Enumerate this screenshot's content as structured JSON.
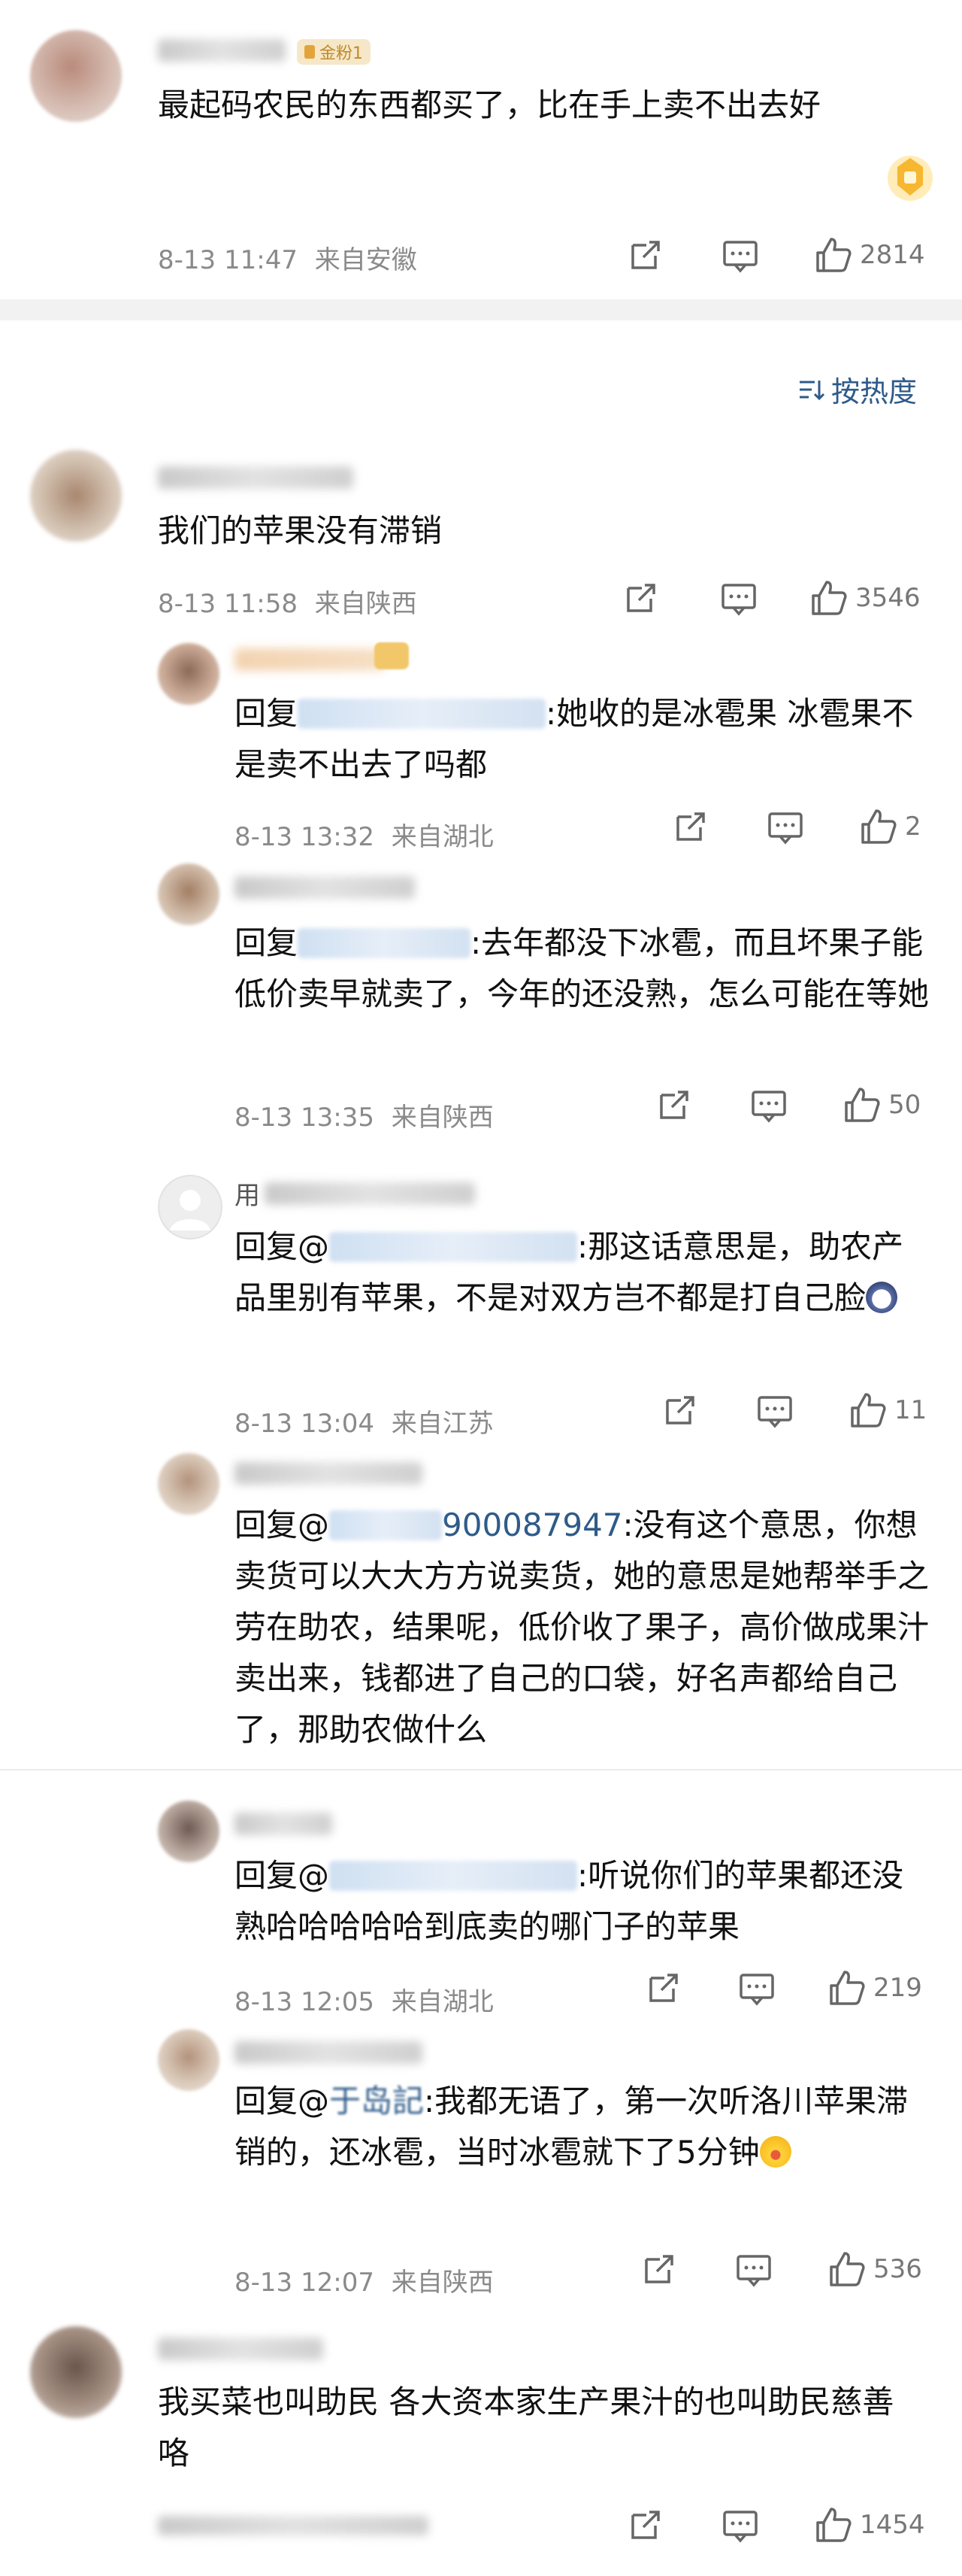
{
  "comments": [
    {
      "text": "最起码农民的东西都买了，比在手上卖不出去好",
      "time": "8-13 11:47",
      "location": "来自安徽",
      "likes": "2814"
    },
    {
      "text": "我们的苹果没有滞销",
      "time": "8-13 11:58",
      "location": "来自陕西",
      "likes": "3546"
    },
    {
      "text": "我买菜也叫助民 各大资本家生产果汁的也叫助民慈善咯",
      "likes": "1454"
    }
  ],
  "badge_label": "金粉1",
  "sort_label": "按热度",
  "replies": [
    {
      "prefix": "回复",
      "mention_text": "",
      "body": ":她收的是冰雹果 冰雹果不是卖不出去了吗都",
      "time": "8-13 13:32",
      "location": "来自湖北",
      "likes": "2"
    },
    {
      "prefix": "回复",
      "mention_text": "",
      "body": ":去年都没下冰雹，而且坏果子能低价卖早就卖了，今年的还没熟，怎么可能在等她",
      "time": "8-13 13:35",
      "location": "来自陕西",
      "likes": "50"
    },
    {
      "prefix": "回复@",
      "mention_text": "",
      "body": ":那这话意思是，助农产品里别有苹果，不是对双方岂不都是打自己脸",
      "time": "8-13 13:04",
      "location": "来自江苏",
      "likes": "11"
    },
    {
      "prefix": "回复@",
      "mention_text": "900087947",
      "body": ":没有这个意思，你想卖货可以大大方方说卖货，她的意思是她帮举手之劳在助农，结果呢，低价收了果子，高价做成果汁卖出来，钱都进了自己的口袋，好名声都给自己了，那助农做什么"
    },
    {
      "prefix": "回复@",
      "mention_text": "",
      "body": ":听说你们的苹果都还没熟哈哈哈哈哈到底卖的哪门子的苹果",
      "time": "8-13 12:05",
      "location": "来自湖北",
      "likes": "219"
    },
    {
      "prefix": "回复@",
      "mention_text": "于岛記",
      "body": ":我都无语了，第一次听洛川苹果滞销的，还冰雹，当时冰雹就下了5分钟",
      "time": "8-13 12:07",
      "location": "来自陕西",
      "likes": "536"
    }
  ],
  "reply_partial_names": [
    "用",
    "于岛記"
  ],
  "colors": {
    "meta": "#8a8a8a",
    "link": "#2e5b8a",
    "badge_bg": "#f6e7c8",
    "badge_fg": "#c08a2a"
  },
  "icons": [
    "share-icon",
    "comment-icon",
    "like-icon",
    "gift-icon",
    "sort-icon",
    "laugh-emoji",
    "dog-emoji"
  ]
}
